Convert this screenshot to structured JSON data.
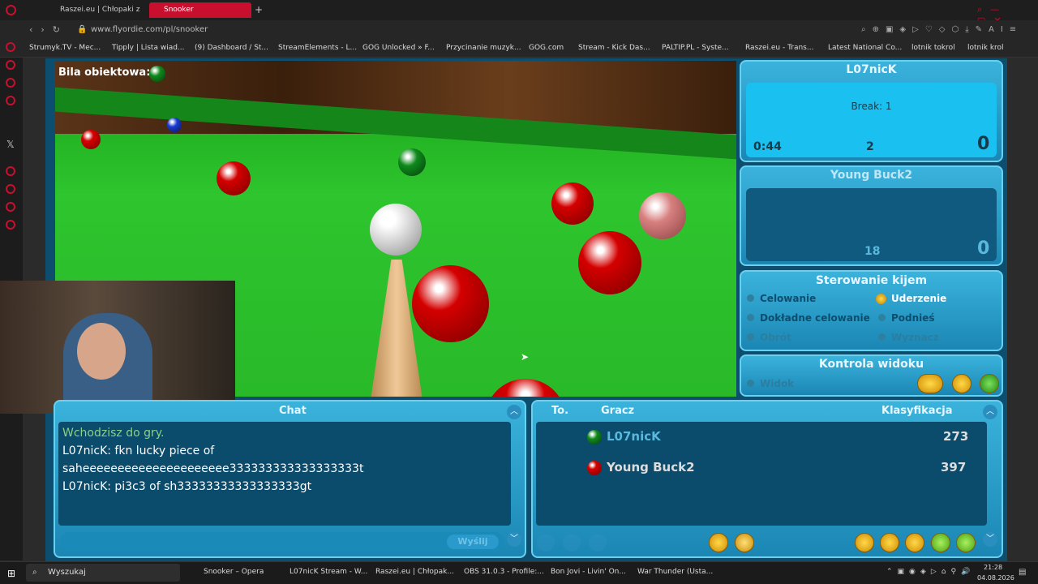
{
  "browser": {
    "tabs": [
      {
        "label": "Raszei.eu | Chłopaki z Ras"
      },
      {
        "label": "Snooker"
      }
    ],
    "url": "www.flyordie.com/pl/snooker",
    "bookmarks": [
      "Strumyk.TV - Mec...",
      "Tipply | Lista wiad...",
      "(9) Dashboard / St...",
      "StreamElements - L...",
      "GOG Unlocked » F...",
      "Przycinanie muzyk...",
      "GOG.com",
      "Stream - Kick Das...",
      "PALTIP.PL - Syste...",
      "Raszei.eu - Trans...",
      "Latest National Co...",
      "lotnik tokrol",
      "lotnik krol"
    ]
  },
  "game": {
    "object_ball_label": "Bila obiektowa:",
    "player1": {
      "name": "L07nicK",
      "break": "Break: 1",
      "time": "0:44",
      "pts_left": "2",
      "score": "0"
    },
    "player2": {
      "name": "Young Buck2",
      "pts_left": "18",
      "score": "0"
    },
    "cue_control": {
      "title": "Sterowanie kijem",
      "opt1": "Celowanie",
      "opt2": "Uderzenie",
      "opt3": "Dokładne celowanie",
      "opt4": "Podnieś",
      "opt5": "Obrót",
      "opt6": "Wyznacz"
    },
    "view_control": {
      "title": "Kontrola widoku",
      "opt1": "Widok"
    },
    "chat": {
      "title": "Chat",
      "lines": [
        "Wchodzisz do gry.",
        "L07nicK: fkn lucky piece of",
        "saheeeeeeeeeeeeeeeeeeeee333333333333333333t",
        "L07nicK: pi3c3 of sh33333333333333333gt"
      ],
      "send": "Wyślij"
    },
    "ranking": {
      "col1": "To.",
      "col2": "Gracz",
      "col3": "Klasyfikacja",
      "rows": [
        {
          "name": "L07nicK",
          "rating": "273"
        },
        {
          "name": "Young Buck2",
          "rating": "397"
        }
      ]
    }
  },
  "taskbar": {
    "search": "Wyszukaj",
    "items": [
      "Snooker – Opera",
      "L07nicK Stream - W...",
      "Raszei.eu | Chłopak...",
      "OBS 31.0.3 - Profile:...",
      "Bon Jovi - Livin' On...",
      "War Thunder (Usta..."
    ],
    "time": "21:28",
    "date": "04.08.2026"
  },
  "colors": {
    "accent": "#c8102e",
    "panel": "#1b86b4"
  }
}
